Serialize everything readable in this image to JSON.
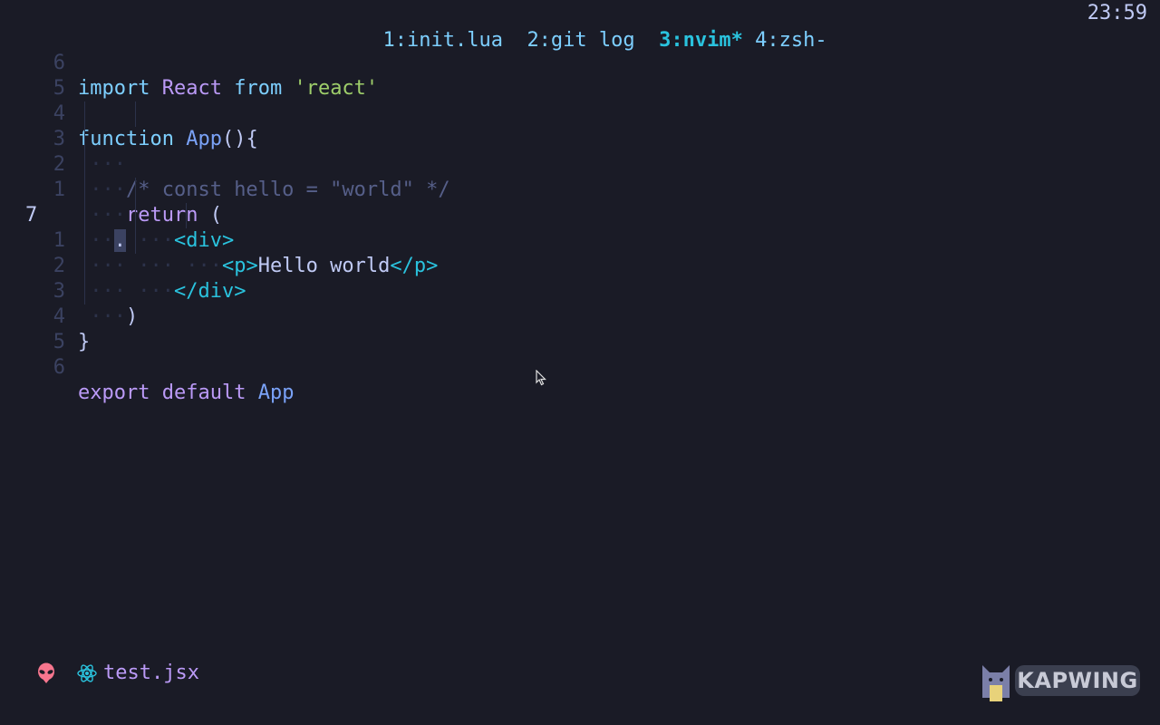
{
  "tmux": {
    "tabs": [
      {
        "label": "1:init.lua",
        "active": false
      },
      {
        "label": "2:git log",
        "active": false
      },
      {
        "label": "3:nvim*",
        "active": true
      },
      {
        "label": "4:zsh-",
        "active": false
      }
    ],
    "clock": "23:59"
  },
  "editor": {
    "language": "jsx",
    "lines": [
      {
        "number": "6",
        "text": "import React from 'react'"
      },
      {
        "number": "5",
        "text": ""
      },
      {
        "number": "4",
        "text": "function App(){"
      },
      {
        "number": "3",
        "text": "  ··· "
      },
      {
        "number": "2",
        "text": "  ···/* const hello = \"world\" */"
      },
      {
        "number": "1",
        "text": "  ···return ("
      },
      {
        "number": "7",
        "text": "  ··.│···<div>",
        "current": true
      },
      {
        "number": "1",
        "text": "  ···│···│···<p>Hello world</p>"
      },
      {
        "number": "2",
        "text": "  ···│···</div>"
      },
      {
        "number": "3",
        "text": "  ···)"
      },
      {
        "number": "4",
        "text": "}"
      },
      {
        "number": "5",
        "text": ""
      },
      {
        "number": "6",
        "text": "export default App"
      }
    ]
  },
  "statusline": {
    "left_icon": "alien-icon",
    "file_icon": "react-icon",
    "filename": "test.jsx"
  },
  "watermark": {
    "label": "KAPWING"
  },
  "colors": {
    "background": "#1a1b26",
    "keyword": "#7dcfff",
    "keyword2": "#bb9af7",
    "identifier": "#7aa2f7",
    "string": "#9ece6a",
    "comment": "#565f89",
    "tag": "#2ac3de",
    "alien": "#f7768e"
  }
}
